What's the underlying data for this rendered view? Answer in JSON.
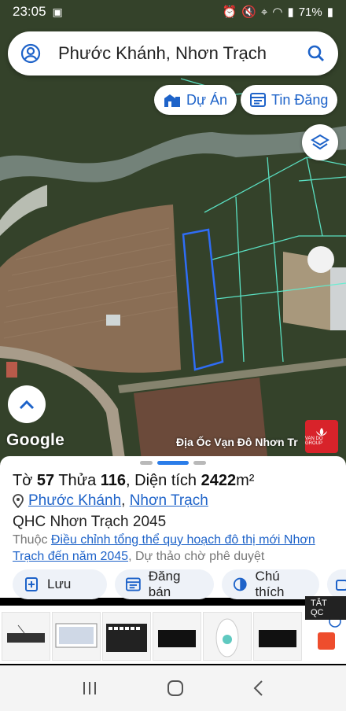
{
  "status_bar": {
    "time": "23:05",
    "battery": "71%"
  },
  "search": {
    "query": "Phước Khánh, Nhơn Trạch"
  },
  "map_chips": {
    "projects": "Dự Án",
    "listings": "Tin Đăng"
  },
  "map": {
    "attribution": "Google",
    "ad_label": "Địa Ốc Vạn Đô Nhơn Tr",
    "ad_logo_text": "VAN DO GROUP"
  },
  "parcel": {
    "title_prefix": "Tờ ",
    "sheet_no": "57",
    "plot_label": " Thửa ",
    "plot_no": "116",
    "area_label": ", Diện tích ",
    "area": "2422",
    "area_unit": "m²",
    "ward": "Phước Khánh",
    "separator": ", ",
    "district": "Nhơn Trạch",
    "plan_code": "QHC Nhơn Trạch 2045",
    "note_prefix": "Thuộc ",
    "note_link": "Điều chỉnh tổng thể quy hoạch đô thị mới Nhơn Trạch đến năm 2045",
    "note_suffix": ", Dự thảo chờ phê duyệt"
  },
  "actions": {
    "save": "Lưu",
    "post_sale": "Đăng bán",
    "legend": "Chú thích"
  },
  "ads_strip": {
    "close_label": "TẮT QC"
  }
}
